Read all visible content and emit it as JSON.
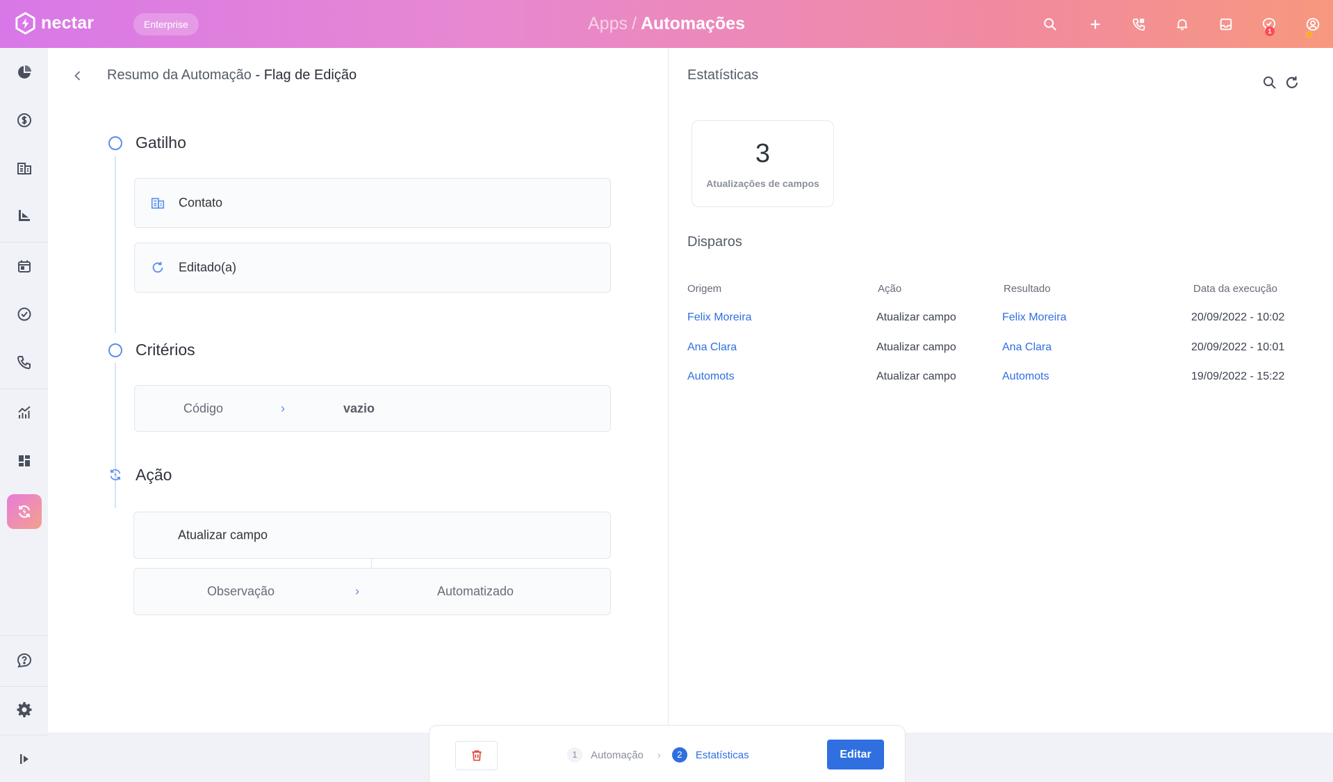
{
  "topbar": {
    "logo_text": "nectar",
    "plan_badge": "Enterprise",
    "breadcrumb_parent": "Apps",
    "breadcrumb_sep": "/",
    "breadcrumb_current": "Automações",
    "notification_count": "1",
    "icons": [
      "search-icon",
      "plus-icon",
      "phone-icon",
      "bell-icon",
      "inbox-icon",
      "chat-icon",
      "user-icon"
    ]
  },
  "sidebar": {
    "items": [
      "dashboard-icon",
      "dollar-icon",
      "building-icon",
      "funnel-icon",
      "calendar-icon",
      "check-circle-icon",
      "phone-call-icon",
      "chart-icon",
      "grid-icon",
      "automation-icon",
      "help-icon",
      "settings-icon",
      "collapse-icon"
    ],
    "active": "automation-icon"
  },
  "summary": {
    "title": "Resumo da Automação",
    "separator": "-",
    "subtitle": "Flag de Edição",
    "trigger": {
      "title": "Gatilho",
      "entity": "Contato",
      "event": "Editado(a)"
    },
    "criteria": {
      "title": "Critérios",
      "field": "Código",
      "arrow": "›",
      "value": "vazio"
    },
    "action": {
      "title": "Ação",
      "name": "Atualizar campo",
      "field": "Observação",
      "arrow": "›",
      "value": "Automatizado"
    }
  },
  "statistics": {
    "title": "Estatísticas",
    "kpi_value": "3",
    "kpi_label": "Atualizações de campos",
    "disparos_title": "Disparos",
    "columns": [
      "Origem",
      "Ação",
      "Resultado",
      "Data da execução"
    ],
    "rows": [
      {
        "origem": "Felix Moreira",
        "acao": "Atualizar campo",
        "resultado": "Felix Moreira",
        "data": "20/09/2022 - 10:02"
      },
      {
        "origem": "Ana Clara",
        "acao": "Atualizar campo",
        "resultado": "Ana Clara",
        "data": "20/09/2022 - 10:01"
      },
      {
        "origem": "Automots",
        "acao": "Atualizar campo",
        "resultado": "Automots",
        "data": "19/09/2022 - 15:22"
      }
    ]
  },
  "footer": {
    "steps": [
      {
        "num": "1",
        "label": "Automação"
      },
      {
        "num": "2",
        "label": "Estatísticas"
      }
    ],
    "active_step": "2",
    "edit_label": "Editar"
  },
  "colors": {
    "accent": "#2f6fe0",
    "gradient_start": "#d878e8",
    "gradient_end": "#f7987e",
    "danger": "#e2463c"
  }
}
